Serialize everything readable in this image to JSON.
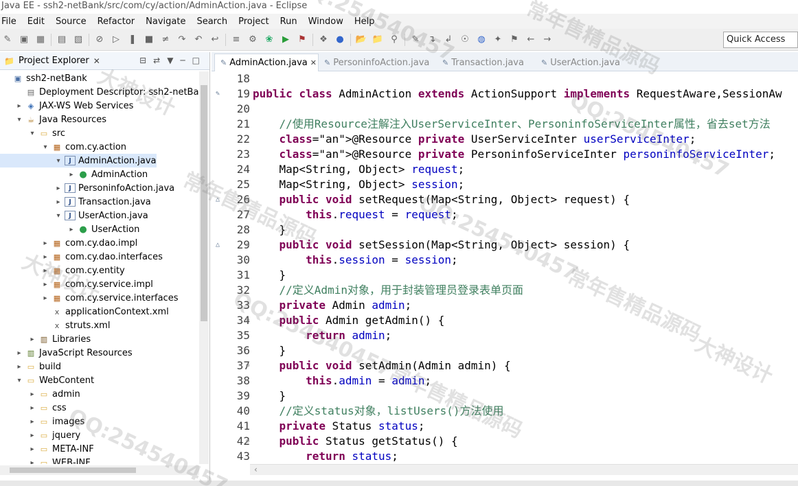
{
  "window": {
    "title": "Java EE - ssh2-netBank/src/com/cy/action/AdminAction.java - Eclipse"
  },
  "menu": [
    "File",
    "Edit",
    "Source",
    "Refactor",
    "Navigate",
    "Search",
    "Project",
    "Run",
    "Window",
    "Help"
  ],
  "toolbar": {
    "quick_access": "Quick Access"
  },
  "project_explorer": {
    "title": "Project Explorer",
    "tree": [
      {
        "label": "ssh2-netBank",
        "icon": "project-icon"
      },
      {
        "label": "Deployment Descriptor: ssh2-netBank",
        "icon": "descriptor-icon"
      },
      {
        "label": "JAX-WS Web Services",
        "icon": "webservice-icon"
      },
      {
        "label": "Java Resources",
        "icon": "java-resources-icon"
      },
      {
        "label": "src",
        "icon": "folder-icon"
      },
      {
        "label": "com.cy.action",
        "icon": "package-icon"
      },
      {
        "label": "AdminAction.java",
        "icon": "java-file-icon"
      },
      {
        "label": "AdminAction",
        "icon": "class-icon"
      },
      {
        "label": "PersoninfoAction.java",
        "icon": "java-file-icon"
      },
      {
        "label": "Transaction.java",
        "icon": "java-file-icon"
      },
      {
        "label": "UserAction.java",
        "icon": "java-file-icon"
      },
      {
        "label": "UserAction",
        "icon": "class-icon"
      },
      {
        "label": "com.cy.dao.impl",
        "icon": "package-icon"
      },
      {
        "label": "com.cy.dao.interfaces",
        "icon": "package-icon"
      },
      {
        "label": "com.cy.entity",
        "icon": "package-icon"
      },
      {
        "label": "com.cy.service.impl",
        "icon": "package-icon"
      },
      {
        "label": "com.cy.service.interfaces",
        "icon": "package-icon"
      },
      {
        "label": "applicationContext.xml",
        "icon": "xml-file-icon"
      },
      {
        "label": "struts.xml",
        "icon": "xml-file-icon"
      },
      {
        "label": "Libraries",
        "icon": "libraries-icon"
      },
      {
        "label": "JavaScript Resources",
        "icon": "js-resources-icon"
      },
      {
        "label": "build",
        "icon": "folder-icon"
      },
      {
        "label": "WebContent",
        "icon": "folder-icon"
      },
      {
        "label": "admin",
        "icon": "folder-icon"
      },
      {
        "label": "css",
        "icon": "folder-icon"
      },
      {
        "label": "images",
        "icon": "folder-icon"
      },
      {
        "label": "jquery",
        "icon": "folder-icon"
      },
      {
        "label": "META-INF",
        "icon": "folder-icon"
      },
      {
        "label": "WEB-INF",
        "icon": "folder-icon"
      }
    ]
  },
  "editor": {
    "tabs": [
      "AdminAction.java",
      "PersoninfoAction.java",
      "Transaction.java",
      "UserAction.java"
    ],
    "code": [
      {
        "n": "18",
        "t": ""
      },
      {
        "n": "19",
        "t": "public class AdminAction extends ActionSupport implements RequestAware,SessionAw"
      },
      {
        "n": "20",
        "t": ""
      },
      {
        "n": "21",
        "t": "    //使用Resource注解注入UserServiceInter、PersoninfoServiceInter属性，省去set方法"
      },
      {
        "n": "22",
        "t": "    @Resource private UserServiceInter userServiceInter;"
      },
      {
        "n": "23",
        "t": "    @Resource private PersoninfoServiceInter personinfoServiceInter;"
      },
      {
        "n": "24",
        "t": "    Map<String, Object> request;"
      },
      {
        "n": "25",
        "t": "    Map<String, Object> session;"
      },
      {
        "n": "26",
        "t": "    public void setRequest(Map<String, Object> request) {"
      },
      {
        "n": "27",
        "t": "        this.request = request;"
      },
      {
        "n": "28",
        "t": "    }"
      },
      {
        "n": "29",
        "t": "    public void setSession(Map<String, Object> session) {"
      },
      {
        "n": "30",
        "t": "        this.session = session;"
      },
      {
        "n": "31",
        "t": "    }"
      },
      {
        "n": "32",
        "t": "    //定义Admin对象，用于封装管理员登录表单页面"
      },
      {
        "n": "33",
        "t": "    private Admin admin;"
      },
      {
        "n": "34",
        "t": "    public Admin getAdmin() {"
      },
      {
        "n": "35",
        "t": "        return admin;"
      },
      {
        "n": "36",
        "t": "    }"
      },
      {
        "n": "37",
        "t": "    public void setAdmin(Admin admin) {"
      },
      {
        "n": "38",
        "t": "        this.admin = admin;"
      },
      {
        "n": "39",
        "t": "    }"
      },
      {
        "n": "40",
        "t": "    //定义status对象，listUsers()方法使用"
      },
      {
        "n": "41",
        "t": "    private Status status;"
      },
      {
        "n": "42",
        "t": "    public Status getStatus() {"
      },
      {
        "n": "43",
        "t": "        return status;"
      }
    ]
  },
  "watermarks": [
    "QQ:254540457",
    "常年售精品源码",
    "大神设计",
    "QQ:254540457",
    "常年售精品源码",
    "QQ:254540457",
    "大神设计",
    "常年售精品源码",
    "QQ:254540457",
    "大神设计",
    "常年售精品源码",
    "QQ:254540457"
  ]
}
